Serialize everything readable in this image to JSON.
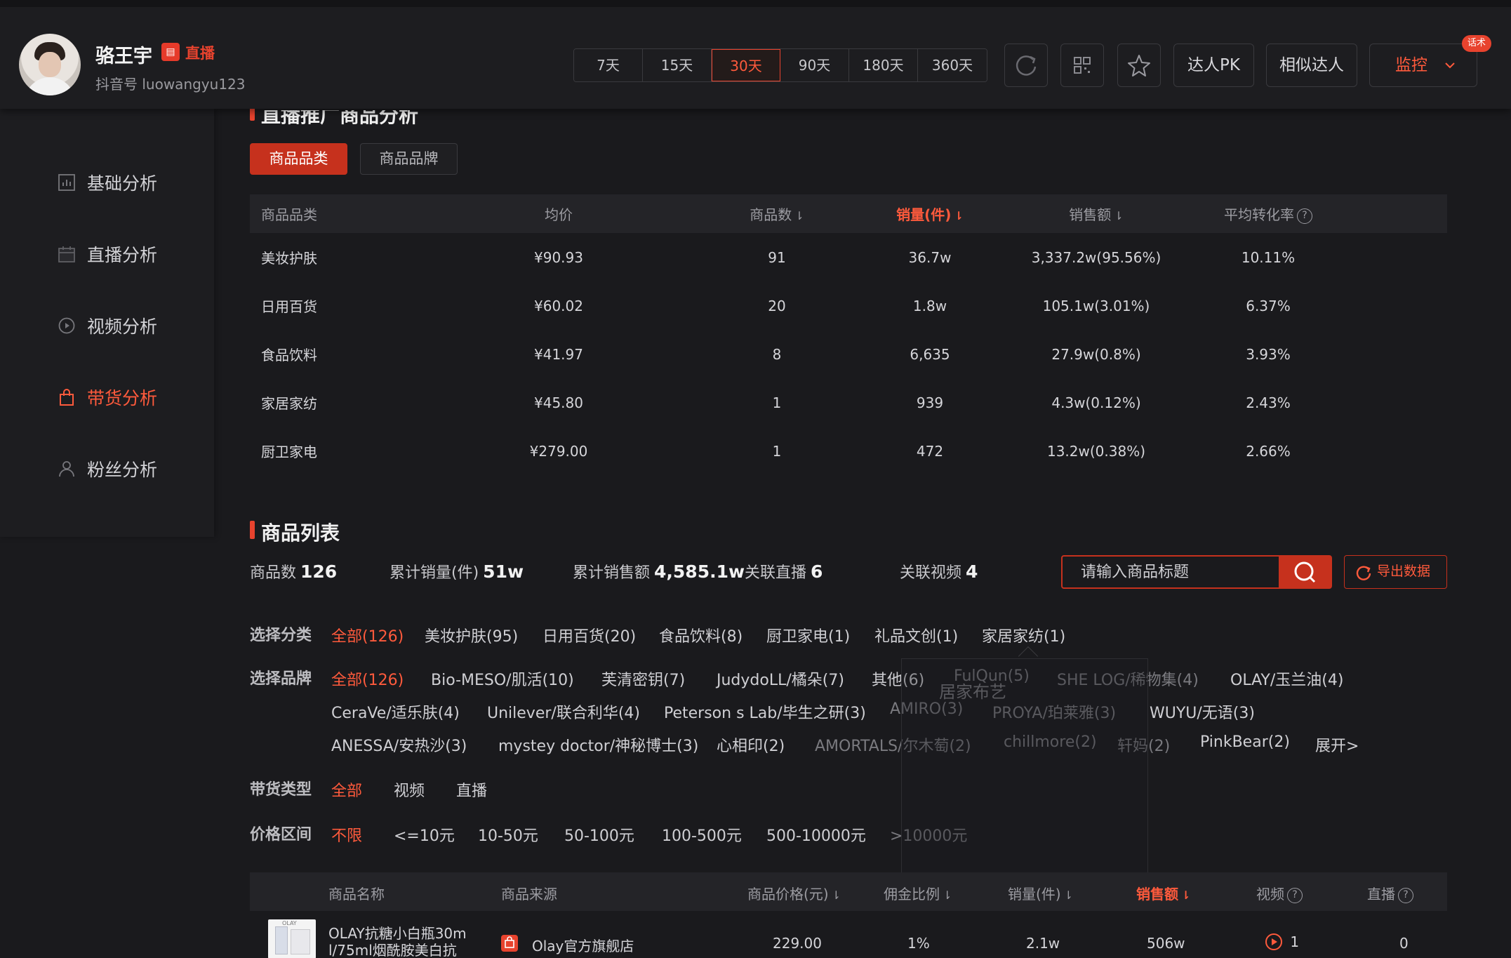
{
  "profile": {
    "name": "骆王宇",
    "live_badge": "▤",
    "live_label": "直播",
    "handle": "抖音号 luowangyu123"
  },
  "header": {
    "day_ranges": [
      "7天",
      "15天",
      "30天",
      "90天",
      "180天",
      "360天"
    ],
    "active_range": "30天",
    "pk_label": "达人PK",
    "similar_label": "相似达人",
    "monitor_label": "监控",
    "huashu_badge": "话术"
  },
  "sidebar": {
    "items": [
      {
        "label": "基础分析",
        "icon": "bar-chart-icon"
      },
      {
        "label": "直播分析",
        "icon": "live-calendar-icon"
      },
      {
        "label": "视频分析",
        "icon": "play-circle-icon"
      },
      {
        "label": "带货分析",
        "icon": "shopping-bag-icon",
        "active": true
      },
      {
        "label": "粉丝分析",
        "icon": "user-icon"
      }
    ]
  },
  "live_goods": {
    "title": "直播推广商品分析",
    "tabs": [
      "商品品类",
      "商品品牌"
    ],
    "headers": {
      "category": "商品品类",
      "avg_price": "均价",
      "count": "商品数",
      "sales": "销量(件)",
      "revenue": "销售额",
      "conversion": "平均转化率"
    },
    "rows": [
      {
        "category": "美妆护肤",
        "avg_price": "¥90.93",
        "count": "91",
        "sales": "36.7w",
        "revenue": "3,337.2w(95.56%)",
        "conversion": "10.11%"
      },
      {
        "category": "日用百货",
        "avg_price": "¥60.02",
        "count": "20",
        "sales": "1.8w",
        "revenue": "105.1w(3.01%)",
        "conversion": "6.37%"
      },
      {
        "category": "食品饮料",
        "avg_price": "¥41.97",
        "count": "8",
        "sales": "6,635",
        "revenue": "27.9w(0.8%)",
        "conversion": "3.93%"
      },
      {
        "category": "家居家纺",
        "avg_price": "¥45.80",
        "count": "1",
        "sales": "939",
        "revenue": "4.3w(0.12%)",
        "conversion": "2.43%"
      },
      {
        "category": "厨卫家电",
        "avg_price": "¥279.00",
        "count": "1",
        "sales": "472",
        "revenue": "13.2w(0.38%)",
        "conversion": "2.66%"
      }
    ]
  },
  "product_list": {
    "title": "商品列表",
    "stats": {
      "count_label": "商品数",
      "count_value": "126",
      "sales_label": "累计销量(件)",
      "sales_value": "51w",
      "revenue_label": "累计销售额",
      "revenue_value": "4,585.1w",
      "live_label": "关联直播",
      "live_value": "6",
      "video_label": "关联视频",
      "video_value": "4"
    },
    "search_placeholder": "请输入商品标题",
    "export_label": "导出数据",
    "filters": {
      "category_label": "选择分类",
      "categories": [
        "全部(126)",
        "美妆护肤(95)",
        "日用百货(20)",
        "食品饮料(8)",
        "厨卫家电(1)",
        "礼品文创(1)",
        "家居家纺(1)"
      ],
      "brand_label": "选择品牌",
      "brands_row1": [
        "全部(126)",
        "Bio-MESO/肌活(10)",
        "芙清密钥(7)",
        "JudydoLL/橘朵(7)",
        "其他(6)",
        "FulQun(5)",
        "SHE LOG/稀物集(4)",
        "OLAY/玉兰油(4)"
      ],
      "brands_row2": [
        "CeraVe/适乐肤(4)",
        "Unilever/联合利华(4)",
        "Peterson s Lab/毕生之研(3)",
        "AMIRO(3)",
        "PROYA/珀莱雅(3)",
        "WUYU/无语(3)"
      ],
      "brands_row3": [
        "ANESSA/安热沙(3)",
        "mystey doctor/神秘博士(3)",
        "心相印(2)",
        "AMORTALS/尔木萄(2)",
        "chillmore(2)",
        "轩妈(2)",
        "PinkBear(2)",
        "展开>"
      ],
      "type_label": "带货类型",
      "types": [
        "全部",
        "视频",
        "直播"
      ],
      "price_label": "价格区间",
      "prices": [
        "不限",
        "<=10元",
        "10-50元",
        "50-100元",
        "100-500元",
        "500-10000元",
        ">10000元"
      ],
      "popup_text": "居家布艺"
    },
    "table_headers": {
      "name": "商品名称",
      "source": "商品来源",
      "price": "商品价格(元)",
      "commission": "佣金比例",
      "sales": "销量(件)",
      "revenue": "销售额",
      "video": "视频",
      "live": "直播"
    },
    "rows": [
      {
        "name_line1": "OLAY抗糖小白瓶30m",
        "name_line2": "l/75ml烟酰胺美白抗",
        "thumb_text": "OLAY",
        "source": "Olay官方旗舰店",
        "price": "229.00",
        "commission": "1%",
        "sales": "2.1w",
        "revenue": "506w",
        "video": "1",
        "live": "0"
      }
    ]
  },
  "colors": {
    "accent": "#ff5a3c",
    "accent_dark": "#c6311d",
    "background": "#1a1a1d",
    "panel": "#1d1d20"
  }
}
